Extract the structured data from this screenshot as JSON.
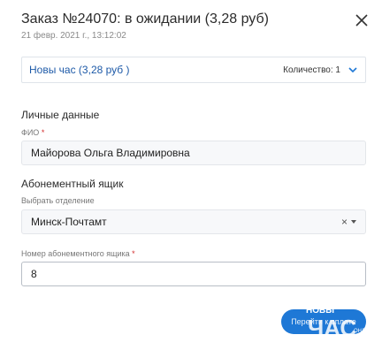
{
  "header": {
    "title": "Заказ №24070: в ожидании (3,28 руб)",
    "date": "21 февр. 2021 г., 13:12:02",
    "close_icon": "close-icon"
  },
  "product": {
    "name": "Новы час (3,28 руб )",
    "quantity_label": "Количество: 1",
    "expand_icon": "chevron-down-icon"
  },
  "personal": {
    "section_title": "Личные данные",
    "fio_label": "ФИО",
    "required_mark": "*",
    "fio_value": "Майорова Ольга Владимировна"
  },
  "po_box": {
    "section_title": "Абонементный ящик",
    "branch_label": "Выбрать отделение",
    "branch_value": "Минск-Почтамт",
    "clear_glyph": "×",
    "box_number_label": "Номер абонементного ящика",
    "box_number_value": "8"
  },
  "footer": {
    "button_label": "Перейти к оплате",
    "watermark_text": [
      "НОВЫ",
      "ЧАС",
      "ОНЛ"
    ]
  },
  "colors": {
    "accent": "#1e78d6",
    "link": "#1e5aa8",
    "required": "#d32f2f"
  }
}
